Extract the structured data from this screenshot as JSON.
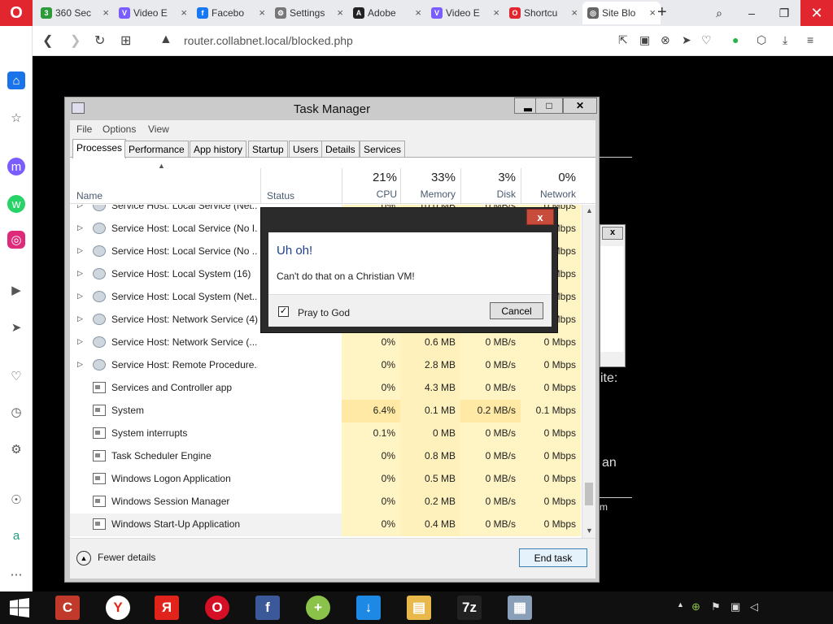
{
  "browser": {
    "tabs": [
      {
        "label": "360 Sec",
        "icon": "360-security-icon",
        "color": "#2e9b3b",
        "glyph": "3"
      },
      {
        "label": "Video E",
        "icon": "video-editor-icon",
        "color": "#7b5cff",
        "glyph": "V"
      },
      {
        "label": "Facebo",
        "icon": "facebook-icon",
        "color": "#1877f2",
        "glyph": "f"
      },
      {
        "label": "Settings",
        "icon": "gear-icon",
        "color": "#777777",
        "glyph": "⚙"
      },
      {
        "label": "Adobe",
        "icon": "adobe-icon",
        "color": "#222222",
        "glyph": "A"
      },
      {
        "label": "Video E",
        "icon": "video-editor-icon",
        "color": "#7b5cff",
        "glyph": "V"
      },
      {
        "label": "Shortcu",
        "icon": "opera-icon",
        "color": "#e2262f",
        "glyph": "O"
      },
      {
        "label": "Site Blo",
        "icon": "globe-icon",
        "color": "#666666",
        "glyph": "◎",
        "active": true
      }
    ],
    "close_glyph": "×",
    "new_tab_glyph": "+",
    "url": "router.collabnet.local/blocked.php",
    "window_glyphs": {
      "search": "⌕",
      "minimize": "–",
      "restore": "❐",
      "close": "✕"
    }
  },
  "page": {
    "fragments": [
      "ite:",
      "an",
      "m"
    ]
  },
  "task_manager": {
    "title": "Task Manager",
    "menu": [
      "File",
      "Options",
      "View"
    ],
    "tabs": [
      "Processes",
      "Performance",
      "App history",
      "Startup",
      "Users",
      "Details",
      "Services"
    ],
    "active_tab": "Processes",
    "columns": {
      "name": "Name",
      "status": "Status",
      "cpu": {
        "pct": "21%",
        "label": "CPU"
      },
      "memory": {
        "pct": "33%",
        "label": "Memory"
      },
      "disk": {
        "pct": "3%",
        "label": "Disk"
      },
      "network": {
        "pct": "0%",
        "label": "Network"
      }
    },
    "rows": [
      {
        "name": "Service Host: Local Service (Net...",
        "cpu": "0%",
        "mem": "10.0 MB",
        "disk": "0 MB/s",
        "net": "0 Mbps",
        "expandable": true,
        "icon": "gear"
      },
      {
        "name": "Service Host: Local Service (No I...",
        "cpu": "0%",
        "mem": "",
        "disk": "",
        "net": "Mbps",
        "expandable": true,
        "icon": "gear"
      },
      {
        "name": "Service Host: Local Service (No ...",
        "cpu": "0%",
        "mem": "",
        "disk": "",
        "net": "Mbps",
        "expandable": true,
        "icon": "gear"
      },
      {
        "name": "Service Host: Local System (16)",
        "cpu": "0%",
        "mem": "",
        "disk": "",
        "net": "Mbps",
        "expandable": true,
        "icon": "gear"
      },
      {
        "name": "Service Host: Local System (Net...",
        "cpu": "0%",
        "mem": "",
        "disk": "",
        "net": "Mbps",
        "expandable": true,
        "icon": "gear"
      },
      {
        "name": "Service Host: Network Service (4)",
        "cpu": "0%",
        "mem": "",
        "disk": "",
        "net": "Mbps",
        "expandable": true,
        "icon": "gear"
      },
      {
        "name": "Service Host: Network Service (...",
        "cpu": "0%",
        "mem": "0.6 MB",
        "disk": "0 MB/s",
        "net": "0 Mbps",
        "expandable": true,
        "icon": "gear"
      },
      {
        "name": "Service Host: Remote Procedure...",
        "cpu": "0%",
        "mem": "2.8 MB",
        "disk": "0 MB/s",
        "net": "0 Mbps",
        "expandable": true,
        "icon": "gear"
      },
      {
        "name": "Services and Controller app",
        "cpu": "0%",
        "mem": "4.3 MB",
        "disk": "0 MB/s",
        "net": "0 Mbps",
        "expandable": false,
        "icon": "app"
      },
      {
        "name": "System",
        "cpu": "6.4%",
        "mem": "0.1 MB",
        "disk": "0.2 MB/s",
        "net": "0.1 Mbps",
        "expandable": false,
        "icon": "app",
        "hot": true
      },
      {
        "name": "System interrupts",
        "cpu": "0.1%",
        "mem": "0 MB",
        "disk": "0 MB/s",
        "net": "0 Mbps",
        "expandable": false,
        "icon": "app"
      },
      {
        "name": "Task Scheduler Engine",
        "cpu": "0%",
        "mem": "0.8 MB",
        "disk": "0 MB/s",
        "net": "0 Mbps",
        "expandable": false,
        "icon": "app"
      },
      {
        "name": "Windows Logon Application",
        "cpu": "0%",
        "mem": "0.5 MB",
        "disk": "0 MB/s",
        "net": "0 Mbps",
        "expandable": false,
        "icon": "app"
      },
      {
        "name": "Windows Session Manager",
        "cpu": "0%",
        "mem": "0.2 MB",
        "disk": "0 MB/s",
        "net": "0 Mbps",
        "expandable": false,
        "icon": "app"
      },
      {
        "name": "Windows Start-Up Application",
        "cpu": "0%",
        "mem": "0.4 MB",
        "disk": "0 MB/s",
        "net": "0 Mbps",
        "expandable": false,
        "icon": "app",
        "selected": true
      }
    ],
    "fewer_details": "Fewer details",
    "end_task": "End task"
  },
  "dialog": {
    "heading": "Uh oh!",
    "message": "Can't do that on a Christian VM!",
    "checkbox_label": "Pray to God",
    "checkbox_checked": true,
    "cancel": "Cancel",
    "close_glyph": "x"
  },
  "taskbar": {
    "apps": [
      {
        "name": "ccleaner-icon",
        "color": "#c0392b",
        "glyph": "C"
      },
      {
        "name": "yandex-browser-icon",
        "color": "#ffffff",
        "glyph": "Y",
        "fg": "#e0241c"
      },
      {
        "name": "yandex-icon",
        "color": "#e0241c",
        "glyph": "Я"
      },
      {
        "name": "opera-icon",
        "color": "#d50f25",
        "glyph": "O"
      },
      {
        "name": "facebook-icon",
        "color": "#3b5998",
        "glyph": "f"
      },
      {
        "name": "add-plus-icon",
        "color": "#8bc34a",
        "glyph": "+"
      },
      {
        "name": "downloader-icon",
        "color": "#1e88e5",
        "glyph": "↓"
      },
      {
        "name": "file-explorer-icon",
        "color": "#e8b84a",
        "glyph": "▤"
      },
      {
        "name": "7zip-icon",
        "color": "#222222",
        "glyph": "7z"
      },
      {
        "name": "task-manager-icon",
        "color": "#8aa0b8",
        "glyph": "▦"
      }
    ]
  }
}
